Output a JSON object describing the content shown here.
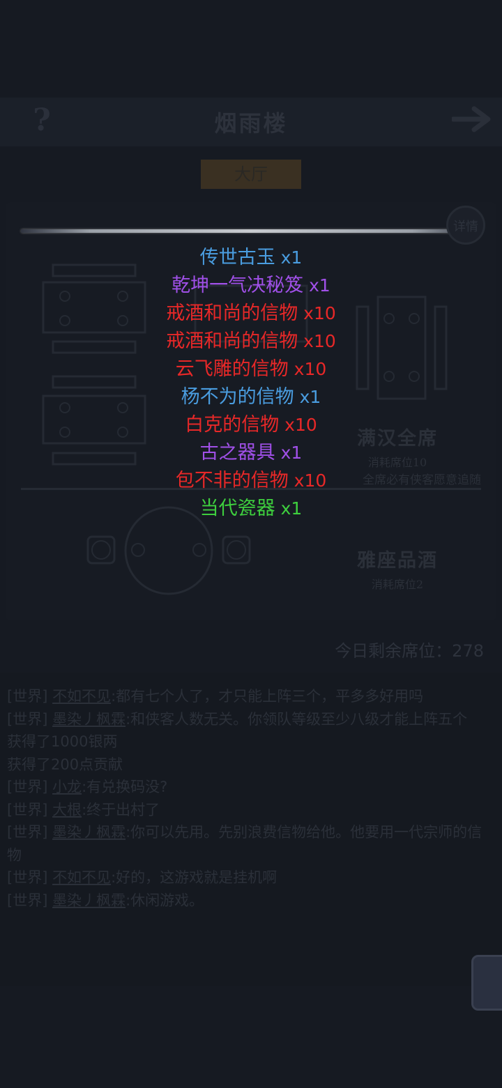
{
  "header": {
    "title": "烟雨楼",
    "help_icon": "question-icon",
    "next_icon": "arrow-right-icon"
  },
  "tab": {
    "label": "大厅"
  },
  "detail_button": {
    "label": "详情"
  },
  "seats": {
    "manhan": {
      "name": "满汉全席",
      "cost": "消耗席位10",
      "desc": "全席必有侠客愿意追随"
    },
    "yazuo": {
      "name": "雅座品酒",
      "cost": "消耗席位2"
    }
  },
  "seats_remaining": "今日剩余席位：278",
  "rewards": [
    {
      "name": "传世古玉",
      "qty": "x1",
      "color": "#4a9de0"
    },
    {
      "name": "乾坤一气决秘笈",
      "qty": "x1",
      "color": "#a050e8"
    },
    {
      "name": "戒酒和尚的信物",
      "qty": "x10",
      "color": "#e82828"
    },
    {
      "name": "戒酒和尚的信物",
      "qty": "x10",
      "color": "#e82828"
    },
    {
      "name": "云飞雕的信物",
      "qty": "x10",
      "color": "#e82828"
    },
    {
      "name": "杨不为的信物",
      "qty": "x1",
      "color": "#4a9de0"
    },
    {
      "name": "白克的信物",
      "qty": "x10",
      "color": "#e82828"
    },
    {
      "name": "古之器具",
      "qty": "x1",
      "color": "#a050e8"
    },
    {
      "name": "包不非的信物",
      "qty": "x10",
      "color": "#e82828"
    },
    {
      "name": "当代瓷器",
      "qty": "x1",
      "color": "#3ecf3e"
    }
  ],
  "chat": [
    {
      "channel": "[世界]",
      "who": "不如不见",
      "text": ":都有七个人了，才只能上阵三个，平多多好用吗"
    },
    {
      "channel": "[世界]",
      "who": "墨染丿枫霖",
      "text": ":和侠客人数无关。你领队等级至少八级才能上阵五个"
    },
    {
      "channel": "",
      "who": "",
      "text": "获得了1000银两"
    },
    {
      "channel": "",
      "who": "",
      "text": "获得了200点贡献"
    },
    {
      "channel": "[世界]",
      "who": "小龙",
      "text": ":有兑换码没?"
    },
    {
      "channel": "[世界]",
      "who": "大根",
      "text": ":终于出村了"
    },
    {
      "channel": "[世界]",
      "who": "墨染丿枫霖",
      "text": ":你可以先用。先别浪费信物给他。他要用一代宗师的信物"
    },
    {
      "channel": "[世界]",
      "who": "不如不见",
      "text": ":好的，这游戏就是挂机啊"
    },
    {
      "channel": "[世界]",
      "who": "墨染丿枫霖",
      "text": ":休闲游戏。"
    }
  ]
}
